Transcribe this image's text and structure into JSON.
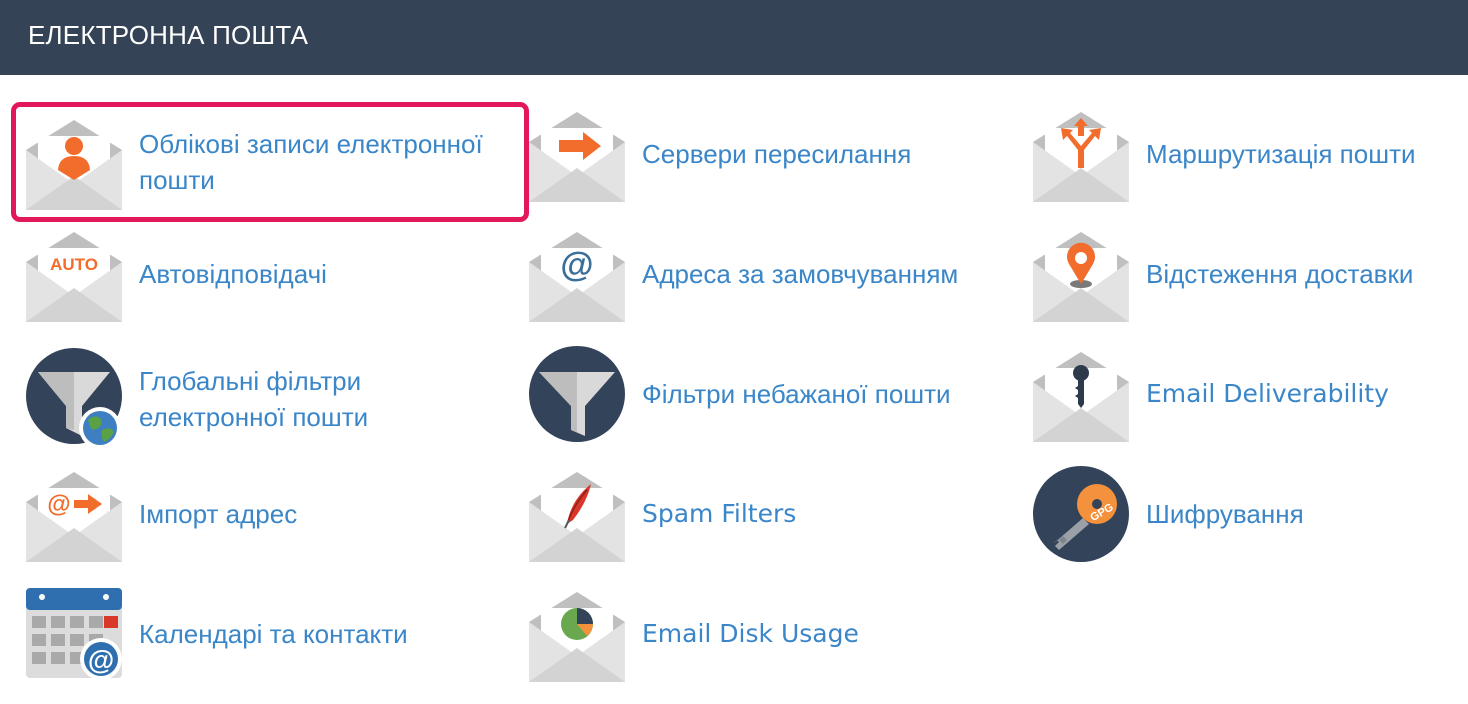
{
  "panel": {
    "title": "ЕЛЕКТРОННА ПОШТА"
  },
  "tools": {
    "email_accounts": {
      "label": "Облікові записи електронної пошти",
      "icon": "envelope-user-icon"
    },
    "forwarders": {
      "label": "Сервери пересилання",
      "icon": "envelope-arrow-icon"
    },
    "email_routing": {
      "label": "Маршрутизація пошти",
      "icon": "envelope-routing-icon"
    },
    "autoresponders": {
      "label": "Автовідповідачі",
      "icon": "envelope-auto-icon",
      "badge": "AUTO"
    },
    "default_address": {
      "label": "Адреса за замовчуванням",
      "icon": "envelope-at-icon",
      "badge": "@"
    },
    "track_delivery": {
      "label": "Відстеження доставки",
      "icon": "envelope-location-pin-icon"
    },
    "global_filters": {
      "label": "Глобальні фільтри електронної пошти",
      "icon": "funnel-globe-icon"
    },
    "user_filters": {
      "label": "Фільтри небажаної пошти",
      "icon": "funnel-icon"
    },
    "email_deliverability": {
      "label": "Email Deliverability",
      "icon": "envelope-key-icon"
    },
    "import_addresses": {
      "label": "Імпорт адрес",
      "icon": "envelope-at-arrow-icon",
      "badge": "@"
    },
    "spam_filters": {
      "label": "Spam Filters",
      "icon": "envelope-feather-icon"
    },
    "encryption": {
      "label": "Шифрування",
      "icon": "gpg-key-icon",
      "badge": "GPG"
    },
    "calendars_contacts": {
      "label": "Календарі та контакти",
      "icon": "calendar-at-icon",
      "badge": "@"
    },
    "email_disk_usage": {
      "label": "Email Disk Usage",
      "icon": "envelope-pie-chart-icon"
    }
  },
  "colors": {
    "header_bg": "#344456",
    "link": "#3a86c8",
    "accent_orange": "#f26c2c",
    "highlight_border": "#e2185b",
    "icon_navy": "#33435a"
  }
}
